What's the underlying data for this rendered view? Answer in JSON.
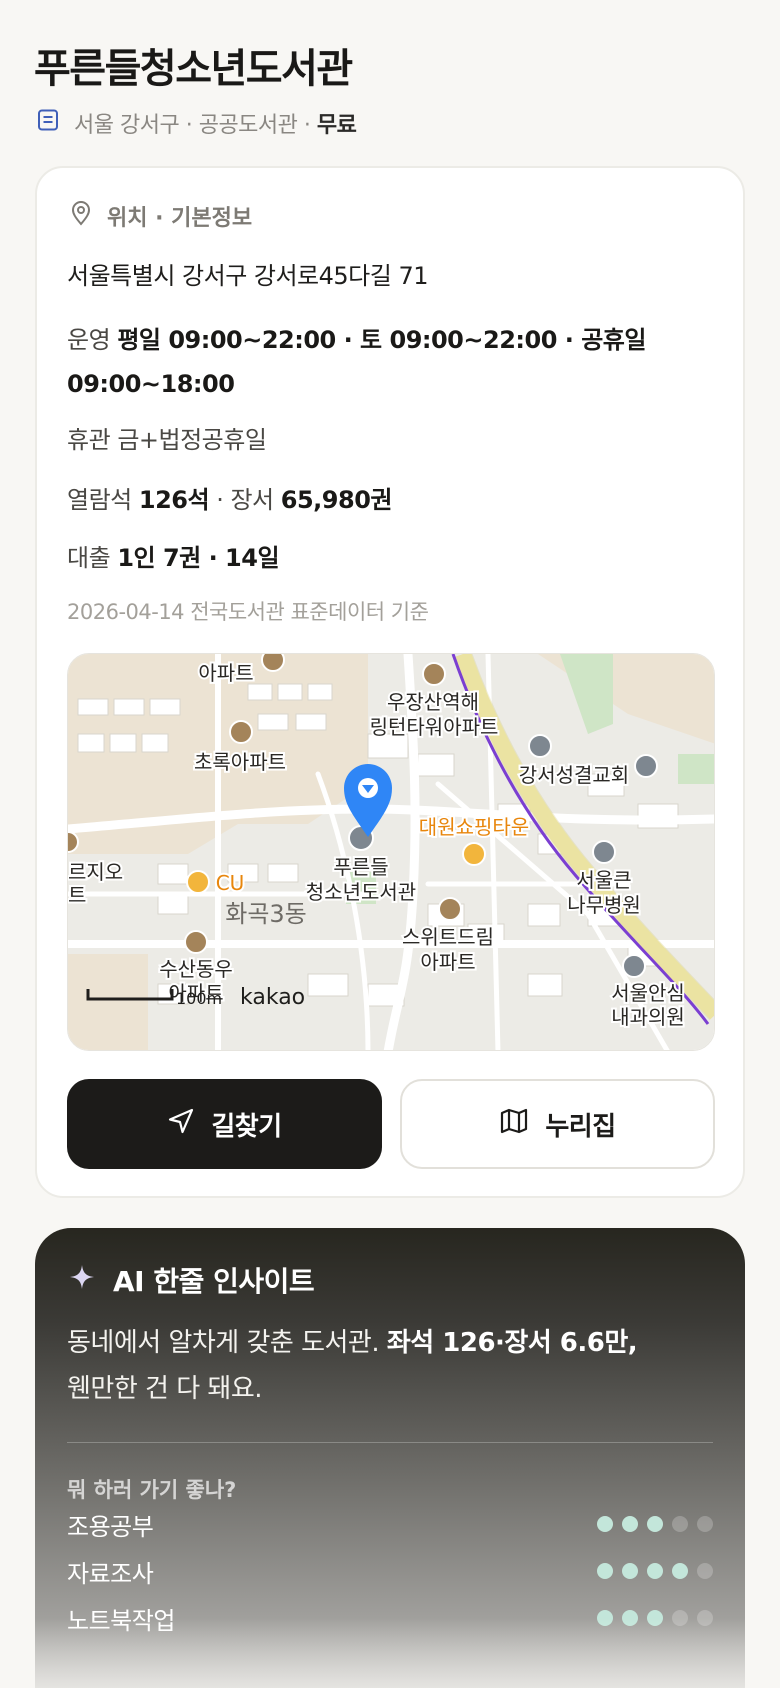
{
  "library": {
    "name": "푸른들청소년도서관",
    "district": "서울 강서구",
    "type": "공공도서관",
    "sep": "·",
    "fee": "무료"
  },
  "info": {
    "section_title": "위치 · 기본정보",
    "address": "서울특별시 강서구 강서로45다길 71",
    "hours_label": "운영",
    "hours_value": "평일 09:00~22:00 · 토 09:00~22:00 · 공휴일 09:00~18:00",
    "closed_label": "휴관",
    "closed_value": "금+법정공휴일",
    "seats_label": "열람석",
    "seats_value": "126석",
    "books_sep": "· 장서",
    "books_value": "65,980권",
    "loan_label": "대출",
    "loan_value": "1인 7권 · 14일",
    "data_basis": "2026-04-14 전국도서관 표준데이터 기준"
  },
  "map": {
    "labels": {
      "apt_top": "아파트",
      "uzang": "우장산역해",
      "lington": "링턴타워아파트",
      "chorok": "초록아파트",
      "church": "강서성결교회",
      "daewon": "대원쇼핑타운",
      "lib1": "푸른들",
      "lib2": "청소년도서관",
      "left1": "르지오",
      "left2": "트",
      "cu": "CU",
      "hwagok": "화곡3동",
      "seoulkeun1": "서울큰",
      "seoulkeun2": "나무병원",
      "sweet1": "스위트드림",
      "sweet2": "아파트",
      "susan1": "수산동우",
      "susan2": "아파트",
      "seoulan1": "서울안심",
      "seoulan2": "내과의원",
      "scale": "100m",
      "brand": "kakao"
    },
    "colors": {
      "pin": "#2f86f6",
      "poi": "#a4845a",
      "subway": "#7b3fd1",
      "road_yellow": "#f6efb0",
      "shop": "#e8860c"
    }
  },
  "buttons": {
    "directions": "길찾기",
    "website": "누리집"
  },
  "ai": {
    "title": "AI 한줄 인사이트",
    "text_plain": "동네에서 알차게 갖춘 도서관. ",
    "text_bold": "좌석 126·장서 6.6만,",
    "text_tail": "웬만한 건 다 돼요.",
    "question": "뭐 하러 가기 좋나?",
    "ratings": [
      {
        "label": "조용공부",
        "score": 3,
        "max": 5
      },
      {
        "label": "자료조사",
        "score": 4,
        "max": 5
      },
      {
        "label": "노트북작업",
        "score": 3,
        "max": 5
      }
    ]
  }
}
